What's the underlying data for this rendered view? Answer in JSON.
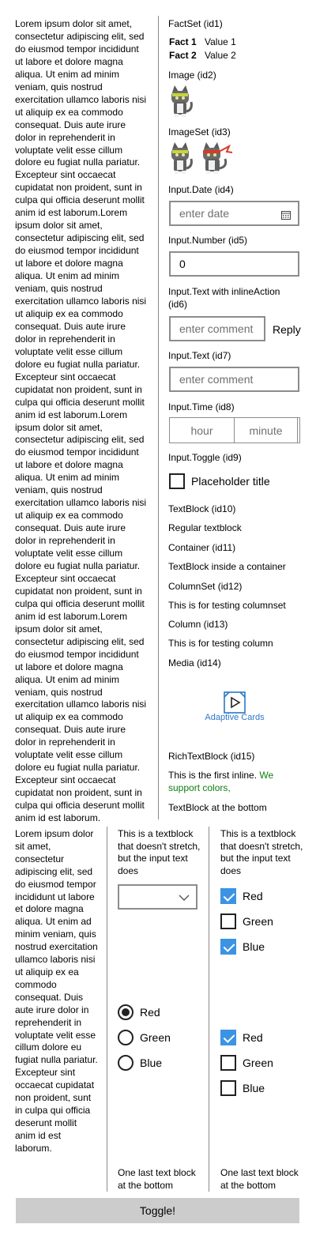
{
  "lorem_top": "Lorem ipsum dolor sit amet, consectetur adipiscing elit, sed do eiusmod tempor incididunt ut labore et dolore magna aliqua. Ut enim ad minim veniam, quis nostrud exercitation ullamco laboris nisi ut aliquip ex ea commodo consequat. Duis aute irure dolor in reprehenderit in voluptate velit esse cillum dolore eu fugiat nulla pariatur. Excepteur sint occaecat cupidatat non proident, sunt in culpa qui officia deserunt mollit anim id est laborum.Lorem ipsum dolor sit amet, consectetur adipiscing elit, sed do eiusmod tempor incididunt ut labore et dolore magna aliqua. Ut enim ad minim veniam, quis nostrud exercitation ullamco laboris nisi ut aliquip ex ea commodo consequat. Duis aute irure dolor in reprehenderit in voluptate velit esse cillum dolore eu fugiat nulla pariatur. Excepteur sint occaecat cupidatat non proident, sunt in culpa qui officia deserunt mollit anim id est laborum.Lorem ipsum dolor sit amet, consectetur adipiscing elit, sed do eiusmod tempor incididunt ut labore et dolore magna aliqua. Ut enim ad minim veniam, quis nostrud exercitation ullamco laboris nisi ut aliquip ex ea commodo consequat. Duis aute irure dolor in reprehenderit in voluptate velit esse cillum dolore eu fugiat nulla pariatur. Excepteur sint occaecat cupidatat non proident, sunt in culpa qui officia deserunt mollit anim id est laborum.Lorem ipsum dolor sit amet, consectetur adipiscing elit, sed do eiusmod tempor incididunt ut labore et dolore magna aliqua. Ut enim ad minim veniam, quis nostrud exercitation ullamco laboris nisi ut aliquip ex ea commodo consequat. Duis aute irure dolor in reprehenderit in voluptate velit esse cillum dolore eu fugiat nulla pariatur. Excepteur sint occaecat cupidatat non proident, sunt in culpa qui officia deserunt mollit anim id est laborum.",
  "right": {
    "factset_title": "FactSet (id1)",
    "facts": [
      {
        "key": "Fact 1",
        "value": "Value 1"
      },
      {
        "key": "Fact 2",
        "value": "Value 2"
      }
    ],
    "image_title": "Image (id2)",
    "imageset_title": "ImageSet (id3)",
    "date_title": "Input.Date (id4)",
    "date_placeholder": "enter date",
    "number_title": "Input.Number (id5)",
    "number_value": "0",
    "inline_title": "Input.Text with inlineAction (id6)",
    "inline_placeholder": "enter comment",
    "inline_action": "Reply",
    "text_title": "Input.Text (id7)",
    "text_placeholder": "enter comment",
    "time_title": "Input.Time (id8)",
    "time_hour": "hour",
    "time_minute": "minute",
    "toggle_title": "Input.Toggle (id9)",
    "toggle_label": "Placeholder title",
    "textblock_title": "TextBlock (id10)",
    "textblock_text": "Regular textblock",
    "container_title": "Container (id11)",
    "container_text": "TextBlock inside a container",
    "columnset_title": "ColumnSet (id12)",
    "columnset_text": "This is for testing columnset",
    "column_title": "Column (id13)",
    "column_text": "This is for testing column",
    "media_title": "Media (id14)",
    "media_caption": "Adaptive Cards",
    "richtext_title": "RichTextBlock (id15)",
    "richtext_black": "This is the first inline. ",
    "richtext_green": "We support colors,",
    "bottom_text": "TextBlock at the bottom"
  },
  "bottom": {
    "lorem": "Lorem ipsum dolor sit amet, consectetur adipiscing elit, sed do eiusmod tempor incididunt ut labore et dolore magna aliqua. Ut enim ad minim veniam, quis nostrud exercitation ullamco laboris nisi ut aliquip ex ea commodo consequat. Duis aute irure dolor in reprehenderit in voluptate velit esse cillum dolore eu fugiat nulla pariatur. Excepteur sint occaecat cupidatat non proident, sunt in culpa qui officia deserunt mollit anim id est laborum.",
    "col2_text": "This is a textblock that doesn't stretch, but the input text does",
    "col2_select_value": "",
    "col2_radios": [
      {
        "label": "Red",
        "checked": true
      },
      {
        "label": "Green",
        "checked": false
      },
      {
        "label": "Blue",
        "checked": false
      }
    ],
    "col2_last": "One last text block at the bottom",
    "col3_text": "This is a textblock that doesn't stretch, but the input text does",
    "col3_checks_a": [
      {
        "label": "Red",
        "checked": true
      },
      {
        "label": "Green",
        "checked": false
      },
      {
        "label": "Blue",
        "checked": true
      }
    ],
    "col3_checks_b": [
      {
        "label": "Red",
        "checked": true
      },
      {
        "label": "Green",
        "checked": false
      },
      {
        "label": "Blue",
        "checked": false
      }
    ],
    "col3_last": "One last text block at the bottom"
  },
  "toggle_button": "Toggle!",
  "colors": {
    "accent": "#3c93e4",
    "green_text": "#107c10",
    "border": "#8c8c8c",
    "button_bg": "#cccccc"
  },
  "icons": [
    "calendar-icon",
    "cat-image",
    "cat-ninja-image",
    "media-play-icon",
    "chevron-down-icon",
    "checkmark-icon"
  ]
}
